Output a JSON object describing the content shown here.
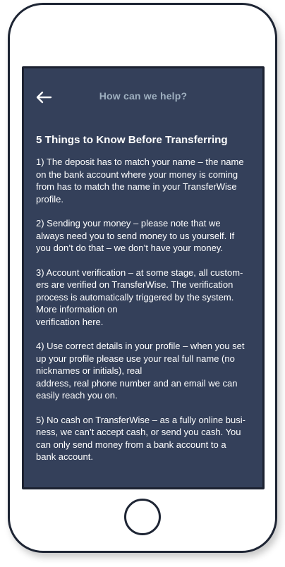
{
  "header": {
    "title": "How can we help?",
    "back_icon": "arrow-left-icon"
  },
  "article": {
    "heading": "5 Things to Know Before Transferring",
    "paragraphs": [
      {
        "lines": [
          "1) The deposit has to match your name – the name",
          "on the bank account where your money is coming",
          "from has to match the name in your TransferWise",
          "profile."
        ]
      },
      {
        "lines": [
          "2) Sending your money – please note that we",
          "always need you to send money to us yourself. If",
          "you don’t do that – we don’t have your money."
        ]
      },
      {
        "lines": [
          "3) Account verification – at some stage, all custom-",
          "ers are verified on TransferWise. The verification",
          "process is automatically triggered by the system.",
          "More information on",
          "verification here."
        ]
      },
      {
        "lines": [
          "4) Use correct details in your profile – when you set",
          "up your profile please use your real full name (no",
          "nicknames or initials), real",
          "address, real phone number and an email we can",
          "easily reach you on."
        ]
      },
      {
        "lines": [
          "5) No cash on TransferWise – as a fully online busi-",
          "ness, we can’t accept cash, or send you cash. You",
          "can only send money from a bank account to a",
          "bank account."
        ]
      }
    ]
  },
  "colors": {
    "screen_background": "#34405a",
    "title_text": "#9fb0c0",
    "body_text": "#ffffff",
    "phone_outline": "#1e2534"
  }
}
